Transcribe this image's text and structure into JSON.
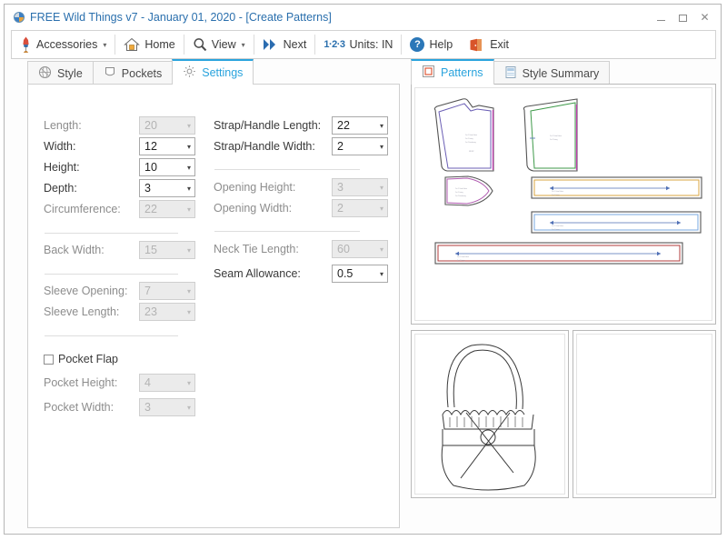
{
  "window": {
    "title": "FREE Wild Things v7 - January 01, 2020 - [Create Patterns]",
    "icon": "app-circle-icon",
    "minimize": "–",
    "maximize": "□",
    "close": "✕",
    "accent_color": "#29a3dd",
    "title_color": "#2a6fad"
  },
  "toolbar": {
    "items": [
      {
        "label": "Accessories",
        "icon": "dress-form-icon",
        "has_caret": true
      },
      {
        "label": "Home",
        "icon": "home-icon",
        "has_caret": false
      },
      {
        "label": "View",
        "icon": "magnifier-icon",
        "has_caret": true
      },
      {
        "label": "Next",
        "icon": "double-chevron-right-icon",
        "has_caret": false
      },
      {
        "label": "Units:  IN",
        "icon": "one-two-three-icon",
        "has_caret": false
      },
      {
        "label": "Help",
        "icon": "question-circle-icon",
        "has_caret": false
      },
      {
        "label": "Exit",
        "icon": "exit-door-icon",
        "has_caret": false
      }
    ],
    "units_glyph": "1·2·3",
    "help_glyph": "?"
  },
  "left_tabs": [
    {
      "label": "Style",
      "icon": "globe-crosshair-icon",
      "active": false
    },
    {
      "label": "Pockets",
      "icon": "pocket-square-icon",
      "active": false
    },
    {
      "label": "Settings",
      "icon": "gear-icon",
      "active": true
    }
  ],
  "right_tabs": [
    {
      "label": "Patterns",
      "icon": "pattern-frame-icon",
      "active": true
    },
    {
      "label": "Style Summary",
      "icon": "document-icon",
      "active": false
    }
  ],
  "settings": {
    "left_column": [
      {
        "label": "Length:",
        "value": "20",
        "enabled": false
      },
      {
        "label": "Width:",
        "value": "12",
        "enabled": true
      },
      {
        "label": "Height:",
        "value": "10",
        "enabled": true
      },
      {
        "label": "Depth:",
        "value": "3",
        "enabled": true
      },
      {
        "label": "Circumference:",
        "value": "22",
        "enabled": false
      },
      {
        "label": "Back Width:",
        "value": "15",
        "enabled": false
      },
      {
        "label": "Sleeve Opening:",
        "value": "7",
        "enabled": false
      },
      {
        "label": "Sleeve Length:",
        "value": "23",
        "enabled": false
      },
      {
        "label": "Pocket Height:",
        "value": "4",
        "enabled": false
      },
      {
        "label": "Pocket Width:",
        "value": "3",
        "enabled": false
      }
    ],
    "pocket_flap": {
      "label": "Pocket Flap",
      "checked": false
    },
    "right_column": [
      {
        "label": "Strap/Handle Length:",
        "value": "22",
        "enabled": true
      },
      {
        "label": "Strap/Handle Width:",
        "value": "2",
        "enabled": true
      },
      {
        "label": "Opening Height:",
        "value": "3",
        "enabled": false
      },
      {
        "label": "Opening Width:",
        "value": "2",
        "enabled": false
      },
      {
        "label": "Neck Tie Length:",
        "value": "60",
        "enabled": false
      },
      {
        "label": "Seam Allowance:",
        "value": "0.5",
        "enabled": true
      }
    ],
    "dropdown_arrow": "▾"
  },
  "patterns": {
    "piece_colors": {
      "front": "#6b5fb5",
      "front_edge": "#c03fb0",
      "back": "#3f9a4a",
      "back_edge": "#c03fb0",
      "flap": "#b05ab0",
      "strap_long": "#d9a441",
      "strap_mid": "#7aa8e0",
      "tie": "#b23b3b",
      "outline": "#555555",
      "dim_arrow": "#4f6fb5"
    },
    "sketch_label": "handbag-line-drawing"
  }
}
